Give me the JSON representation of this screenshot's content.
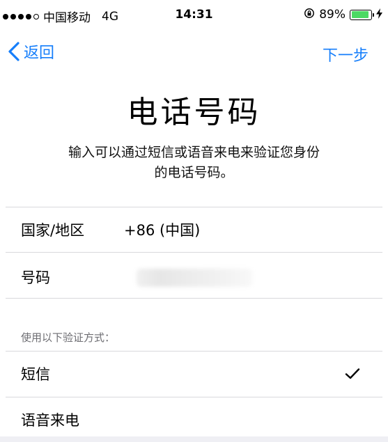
{
  "status_bar": {
    "carrier": "中国移动",
    "network": "4G",
    "time": "14:31",
    "battery_percent": "89%",
    "battery_level": 0.89,
    "rotation_lock_icon": "rotation-lock-icon",
    "charging_icon": "bolt-icon"
  },
  "nav": {
    "back_label": "返回",
    "next_label": "下一步",
    "accent_color": "#157efb"
  },
  "page": {
    "title": "电话号码",
    "description_line1": "输入可以通过短信或语音来电来验证您身份",
    "description_line2": "的电话号码。"
  },
  "form": {
    "country_label": "国家/地区",
    "country_value": "+86 (中国)",
    "number_label": "号码"
  },
  "verification": {
    "section_header": "使用以下验证方式：",
    "options": [
      {
        "label": "短信",
        "selected": true
      },
      {
        "label": "语音来电",
        "selected": false
      }
    ]
  }
}
